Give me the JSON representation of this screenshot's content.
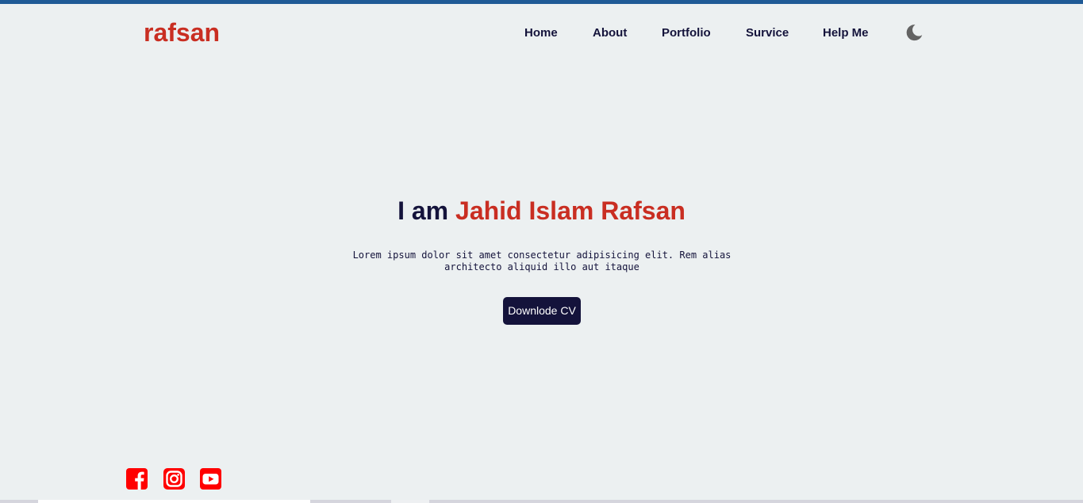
{
  "header": {
    "logo": "rafsan",
    "nav": [
      {
        "label": "Home"
      },
      {
        "label": "About"
      },
      {
        "label": "Portfolio"
      },
      {
        "label": "Survice"
      },
      {
        "label": "Help Me"
      }
    ],
    "theme_toggle_icon": "moon-icon"
  },
  "hero": {
    "title_prefix": "I am ",
    "title_name": "Jahid Islam Rafsan",
    "description": "Lorem ipsum dolor sit amet consectetur adipisicing elit. Rem alias architecto aliquid illo aut itaque",
    "cv_button": "Downlode CV"
  },
  "social": [
    {
      "icon": "facebook-icon"
    },
    {
      "icon": "instagram-icon"
    },
    {
      "icon": "youtube-icon"
    }
  ],
  "colors": {
    "accent": "#c92e22",
    "primary": "#14133b",
    "background": "#ecf0f1",
    "social": "#ff0000",
    "top_strip": "#1f5a96"
  }
}
